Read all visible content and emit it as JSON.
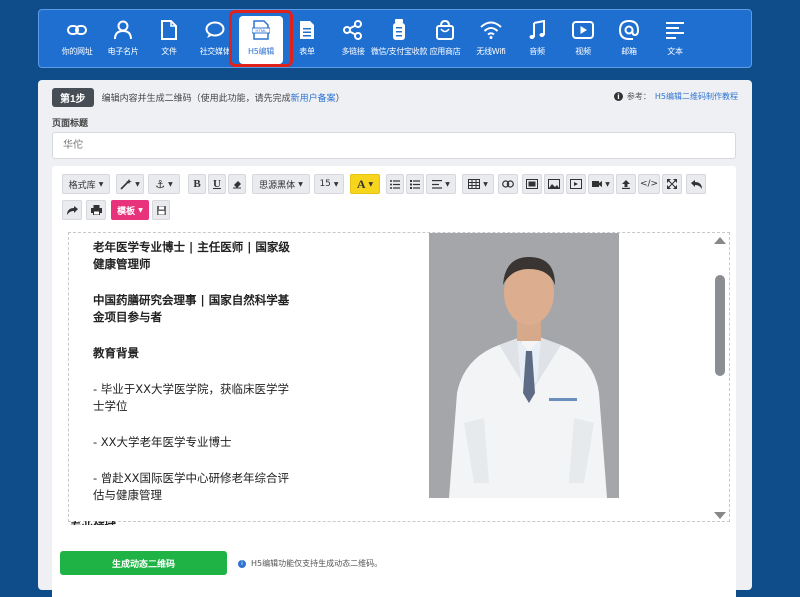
{
  "nav": {
    "items": [
      {
        "label": "你的网址",
        "icon": "link-icon"
      },
      {
        "label": "电子名片",
        "icon": "person-icon"
      },
      {
        "label": "文件",
        "icon": "file-icon"
      },
      {
        "label": "社交媒体",
        "icon": "chat-bubble-icon"
      },
      {
        "label": "H5编辑",
        "icon": "html-file-icon",
        "active": true
      },
      {
        "label": "表单",
        "icon": "form-icon"
      },
      {
        "label": "多链接",
        "icon": "share-icon"
      },
      {
        "label": "微信/支付宝收款",
        "icon": "payment-icon"
      },
      {
        "label": "应用商店",
        "icon": "shopping-bag-icon"
      },
      {
        "label": "无线Wifi",
        "icon": "wifi-icon"
      },
      {
        "label": "音频",
        "icon": "music-note-icon"
      },
      {
        "label": "视频",
        "icon": "video-play-icon"
      },
      {
        "label": "邮箱",
        "icon": "at-sign-icon"
      },
      {
        "label": "文本",
        "icon": "text-lines-icon"
      }
    ],
    "html_icon_text": "HTML"
  },
  "step": {
    "badge": "第1步",
    "text": "编辑内容并生成二维码（使用此功能，请先完成",
    "link": "新用户备案",
    "suffix": "）",
    "ref_label": "参考：",
    "ref_link": "H5编辑二维码制作教程"
  },
  "title_field": {
    "label": "页面标题",
    "value": "华佗"
  },
  "toolbar": {
    "format_lib": "格式库",
    "template": "模板",
    "font": "思源黑体",
    "size": "15",
    "bold": "B",
    "underline": "U",
    "font_color_letter": "A",
    "code": "</>"
  },
  "content": {
    "paragraphs": [
      {
        "text": "老年医学专业博士 | 主任医师 | 国家级健康管理师",
        "bold": true
      },
      {
        "text": "中国药膳研究会理事 | 国家自然科学基金项目参与者",
        "bold": true
      },
      {
        "text": "教育背景",
        "bold": true
      },
      {
        "text": "- 毕业于XX大学医学院，获临床医学学士学位",
        "bold": false
      },
      {
        "text": "-     XX大学老年医学专业博士",
        "bold": false
      },
      {
        "text": "- 曾赴XX国际医学中心研修老年综合评估与健康管理",
        "bold": false
      }
    ],
    "cut_off_heading": "专业领域"
  },
  "generate": {
    "button": "生成动态二维码",
    "note": "H5编辑功能仅支持生成动态二维码。"
  },
  "colors": {
    "page_bg": "#0f4c8a",
    "nav_bg": "#1f6fd1",
    "highlight": "#e0201a",
    "accent": "#2f74d0",
    "template_btn": "#e8337c",
    "generate_btn": "#1fb346"
  }
}
